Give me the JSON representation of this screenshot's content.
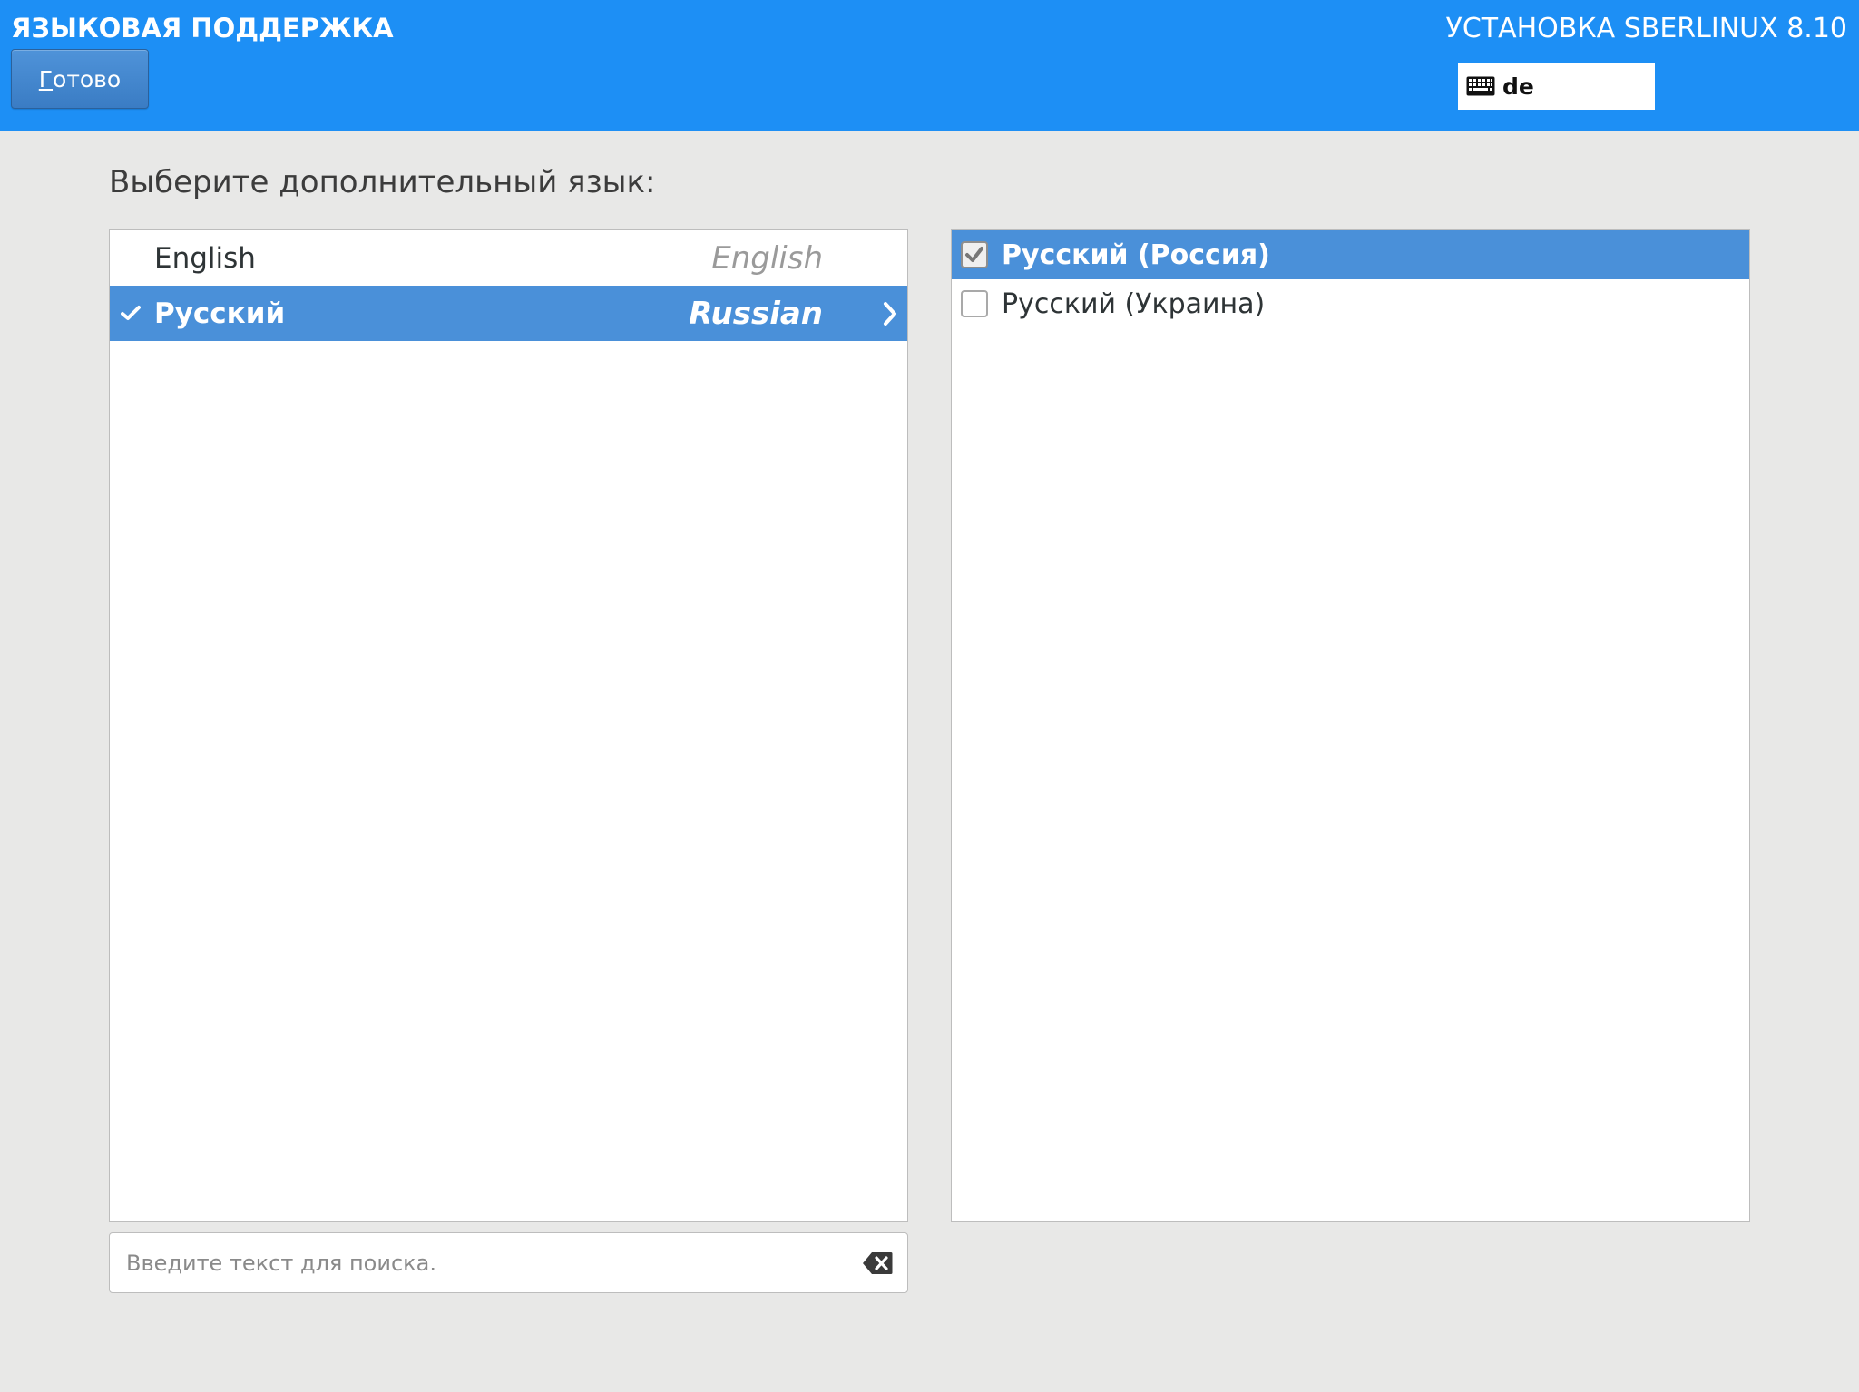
{
  "header": {
    "spoke_title": "ЯЗЫКОВАЯ ПОДДЕРЖКА",
    "done_button": {
      "mnemonic": "Г",
      "rest": "отово"
    },
    "product_title": "УСТАНОВКА SBERLINUX 8.10",
    "keyboard_layout": "de",
    "keyboard_icon": "keyboard-icon"
  },
  "main": {
    "prompt": "Выберите дополнительный язык:",
    "languages": [
      {
        "native": "English",
        "english": "English",
        "selected": false,
        "checked": false
      },
      {
        "native": "Русский",
        "english": "Russian",
        "selected": true,
        "checked": true
      }
    ],
    "locales": [
      {
        "label": "Русский (Россия)",
        "checked": true,
        "selected": true
      },
      {
        "label": "Русский (Украина)",
        "checked": false,
        "selected": false
      }
    ],
    "search": {
      "placeholder": "Введите текст для поиска.",
      "value": "",
      "clear_icon": "clear-text-icon"
    }
  },
  "colors": {
    "header_bg": "#1d8ff5",
    "selection_bg": "#4a90d9",
    "page_bg": "#e8e8e7"
  }
}
